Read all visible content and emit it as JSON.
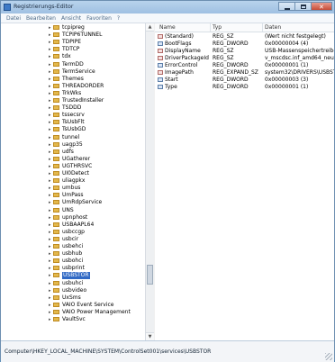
{
  "window": {
    "title": "Registrierungs-Editor"
  },
  "menu": [
    "Datei",
    "Bearbeiten",
    "Ansicht",
    "Favoriten",
    "?"
  ],
  "tree": {
    "items": [
      "tcpipreg",
      "TCPIP6TUNNEL",
      "TDPIPE",
      "TDTCP",
      "tdx",
      "TermDD",
      "TermService",
      "Themes",
      "THREADORDER",
      "TrkWks",
      "TrustedInstaller",
      "TSDDD",
      "tssecsrv",
      "TsUsbFlt",
      "TsUsbGD",
      "tunnel",
      "uagp35",
      "udfs",
      "UGatherer",
      "UGTHRSVC",
      "UI0Detect",
      "uliagpkx",
      "umbus",
      "UmPass",
      "UmRdpService",
      "UNS",
      "upnphost",
      "USBAAPL64",
      "usbccgp",
      "usbcir",
      "usbehci",
      "usbhub",
      "usbohci",
      "usbprint",
      "USBSTOR",
      "usbuhci",
      "usbvideo",
      "UxSms",
      "VAIO Event Service",
      "VAIO Power Management",
      "VaultSvc"
    ],
    "selected": "USBSTOR"
  },
  "list": {
    "headers": {
      "name": "Name",
      "type": "Typ",
      "data": "Daten"
    },
    "rows": [
      {
        "icon": "string-value-icon",
        "name": "(Standard)",
        "type": "REG_SZ",
        "data": "(Wert nicht festgelegt)"
      },
      {
        "icon": "binary-value-icon",
        "name": "BootFlags",
        "type": "REG_DWORD",
        "data": "0x00000004 (4)"
      },
      {
        "icon": "string-value-icon",
        "name": "DisplayName",
        "type": "REG_SZ",
        "data": "USB-Massenspeichertreiber"
      },
      {
        "icon": "string-value-icon",
        "name": "DriverPackageId",
        "type": "REG_SZ",
        "data": "v_mscdsc.inf_amd64_neutral_b"
      },
      {
        "icon": "binary-value-icon",
        "name": "ErrorControl",
        "type": "REG_DWORD",
        "data": "0x00000001 (1)"
      },
      {
        "icon": "string-value-icon",
        "name": "ImagePath",
        "type": "REG_EXPAND_SZ",
        "data": "system32\\DRIVERS\\USBSTOR"
      },
      {
        "icon": "binary-value-icon",
        "name": "Start",
        "type": "REG_DWORD",
        "data": "0x00000003 (3)"
      },
      {
        "icon": "binary-value-icon",
        "name": "Type",
        "type": "REG_DWORD",
        "data": "0x00000001 (1)"
      }
    ]
  },
  "status": {
    "path": "Computer\\HKEY_LOCAL_MACHINE\\SYSTEM\\ControlSet001\\services\\USBSTOR"
  }
}
